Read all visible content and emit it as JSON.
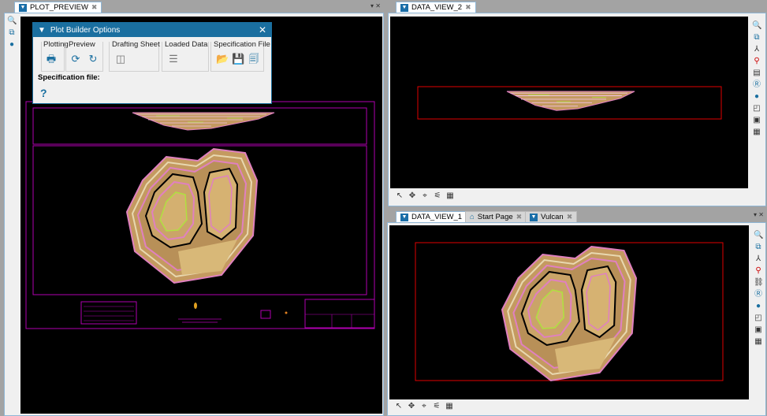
{
  "left_pane": {
    "tab_label": "PLOT_PREVIEW"
  },
  "dialog": {
    "title": "Plot Builder Options",
    "groups": [
      {
        "label": "Plotting"
      },
      {
        "label": "Preview"
      },
      {
        "label": "Drafting Sheet"
      },
      {
        "label": "Loaded Data"
      },
      {
        "label": "Specification File"
      }
    ],
    "spec_label": "Specification file:",
    "help": "?"
  },
  "top_right": {
    "tab_label": "DATA_VIEW_2"
  },
  "bottom_right": {
    "tabs": [
      {
        "label": "DATA_VIEW_1"
      },
      {
        "label": "Start Page"
      },
      {
        "label": "Vulcan"
      }
    ]
  },
  "colors": {
    "accent": "#1a6fa0",
    "frame": "#b000b0",
    "boundary": "#e00000",
    "pit": "#c8a060"
  }
}
